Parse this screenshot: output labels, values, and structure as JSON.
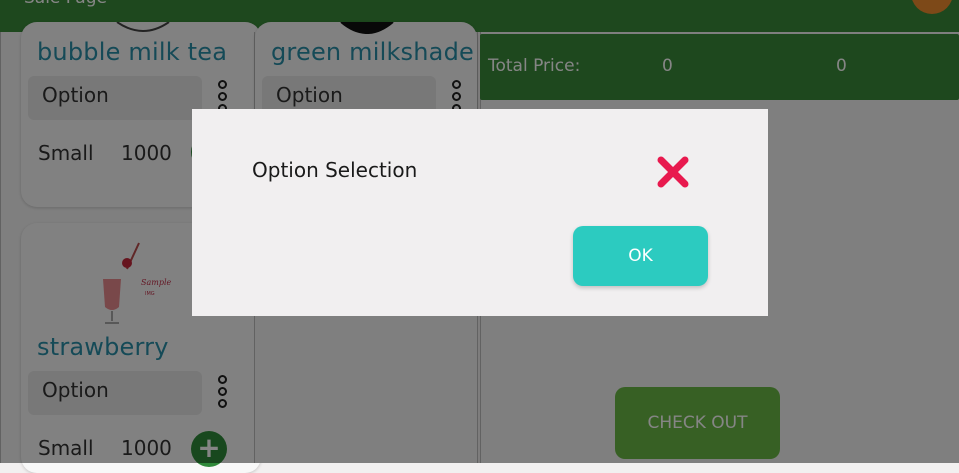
{
  "header": {
    "title": "Sale Page"
  },
  "products": [
    {
      "name": "bubble milk tea",
      "option": "Option",
      "size": "Small",
      "price": "1000"
    },
    {
      "name": "green milkshade",
      "option": "Option"
    },
    {
      "name": "strawberry",
      "option": "Option",
      "size": "Small",
      "price": "1000"
    }
  ],
  "summary": {
    "total_label": "Total Price:",
    "quantity": "0",
    "amount": "0"
  },
  "checkout": {
    "label": "CHECK OUT"
  },
  "modal": {
    "title": "Option Selection",
    "ok_label": "OK"
  },
  "colors": {
    "header_bg": "#3a8a3a",
    "product_title": "#2a8fa8",
    "checkout_bg": "#6ab845",
    "ok_bg": "#2ccbc0",
    "close_icon": "#e8194e"
  }
}
